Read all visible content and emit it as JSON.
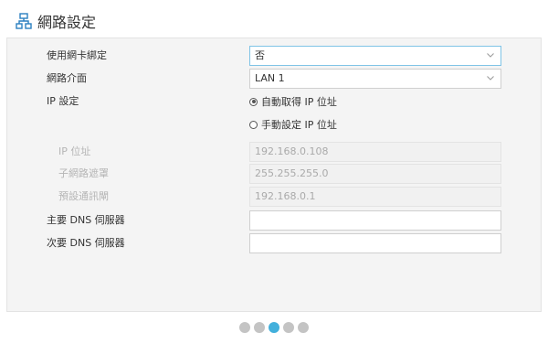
{
  "header": {
    "title": "網路設定",
    "icon": "network-icon"
  },
  "form": {
    "bind_nic": {
      "label": "使用網卡綁定",
      "value": "否"
    },
    "interface": {
      "label": "網路介面",
      "value": "LAN 1"
    },
    "ip_setting": {
      "label": "IP 設定",
      "options": [
        "自動取得 IP 位址",
        "手動設定 IP 位址"
      ],
      "selected": "自動取得 IP 位址"
    },
    "ip_address": {
      "label": "IP 位址",
      "value": "192.168.0.108"
    },
    "subnet": {
      "label": "子網路遮罩",
      "value": "255.255.255.0"
    },
    "gateway": {
      "label": "預設通訊閘",
      "value": "192.168.0.1"
    },
    "primary_dns": {
      "label": "主要 DNS 伺服器",
      "value": ""
    },
    "secondary_dns": {
      "label": "次要 DNS 伺服器",
      "value": ""
    }
  },
  "pager": {
    "pages": 5,
    "active_page": 3
  },
  "colors": {
    "accent": "#43b0dc",
    "focus_border": "#7fc3e6",
    "panel_bg": "#f4f4f4"
  }
}
